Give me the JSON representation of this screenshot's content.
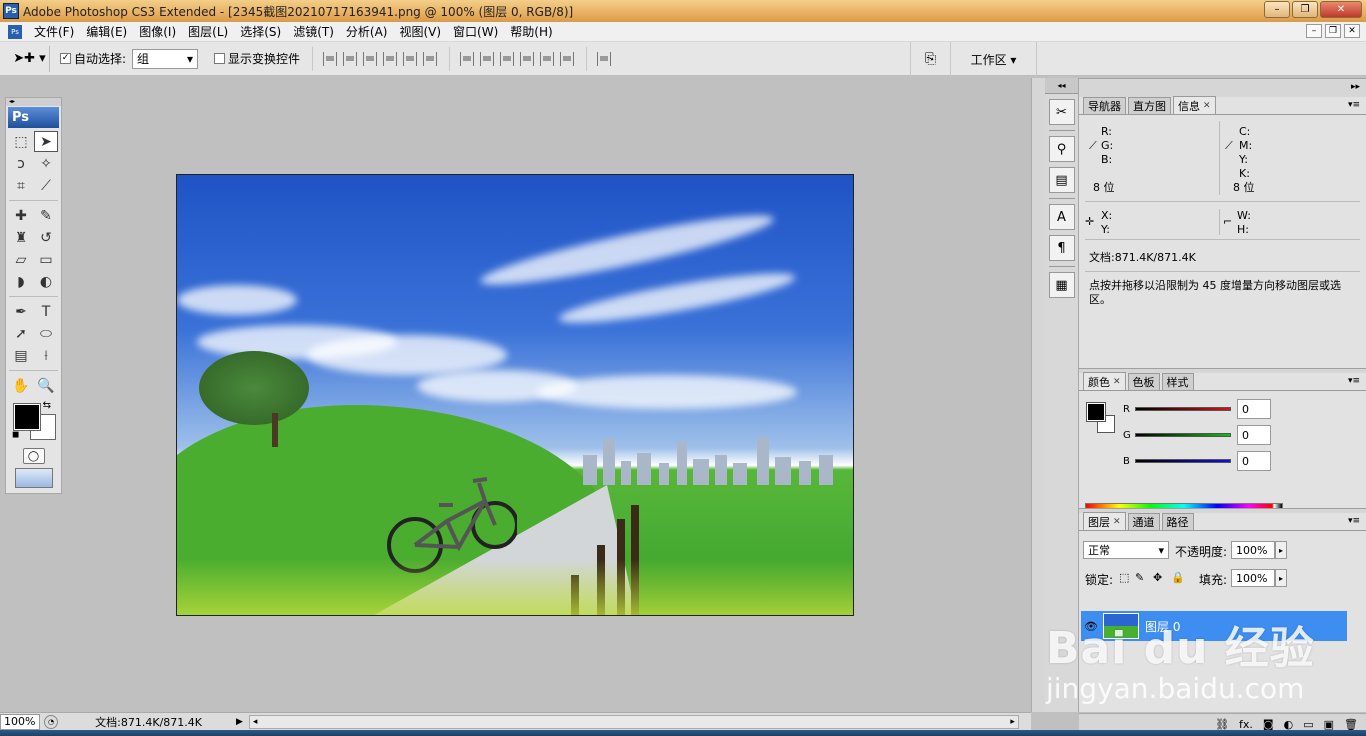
{
  "window": {
    "title": "Adobe Photoshop CS3 Extended - [2345截图20210717163941.png @ 100% (图层 0, RGB/8)]",
    "logo": "Ps",
    "controls": [
      "–",
      "❐",
      "✕"
    ],
    "accent": "#3d8ef0"
  },
  "menu": {
    "items": [
      "文件(F)",
      "编辑(E)",
      "图像(I)",
      "图层(L)",
      "选择(S)",
      "滤镜(T)",
      "分析(A)",
      "视图(V)",
      "窗口(W)",
      "帮助(H)"
    ],
    "doc_controls": [
      "–",
      "❐",
      "✕"
    ]
  },
  "options": {
    "auto_select_label": "自动选择:",
    "auto_select_checked": true,
    "auto_select_value": "组",
    "show_transform_label": "显示变换控件",
    "show_transform_checked": false,
    "workspace_label": "工作区 ▾"
  },
  "toolbox": {
    "header": "Ps",
    "tools": [
      {
        "icon": "marquee-icon",
        "glyph": "⬚"
      },
      {
        "icon": "move-icon",
        "glyph": "➤",
        "active": true
      },
      {
        "icon": "lasso-icon",
        "glyph": "ↄ"
      },
      {
        "icon": "magic-wand-icon",
        "glyph": "✧"
      },
      {
        "icon": "crop-icon",
        "glyph": "⌗"
      },
      {
        "icon": "slice-icon",
        "glyph": "⟋"
      },
      {
        "icon": "healing-icon",
        "glyph": "✚"
      },
      {
        "icon": "brush-icon",
        "glyph": "✎"
      },
      {
        "icon": "stamp-icon",
        "glyph": "♜"
      },
      {
        "icon": "history-brush-icon",
        "glyph": "↺"
      },
      {
        "icon": "eraser-icon",
        "glyph": "▱"
      },
      {
        "icon": "gradient-icon",
        "glyph": "▭"
      },
      {
        "icon": "blur-icon",
        "glyph": "◗"
      },
      {
        "icon": "dodge-icon",
        "glyph": "◐"
      },
      {
        "icon": "pen-icon",
        "glyph": "✒"
      },
      {
        "icon": "type-icon",
        "glyph": "T"
      },
      {
        "icon": "path-select-icon",
        "glyph": "➚"
      },
      {
        "icon": "ellipse-icon",
        "glyph": "⬭"
      },
      {
        "icon": "notes-icon",
        "glyph": "▤"
      },
      {
        "icon": "eyedropper-icon",
        "glyph": "⟊"
      },
      {
        "icon": "hand-icon",
        "glyph": "✋"
      },
      {
        "icon": "zoom-icon",
        "glyph": "🔍"
      }
    ]
  },
  "info_panel": {
    "tabs": [
      "导航器",
      "直方图",
      "信息"
    ],
    "active_tab": "信息",
    "rgb": [
      "R:",
      "G:",
      "B:"
    ],
    "cmyk": [
      "C:",
      "M:",
      "Y:",
      "K:"
    ],
    "bits_left": "8 位",
    "bits_right": "8 位",
    "xy": [
      "X:",
      "Y:"
    ],
    "wh": [
      "W:",
      "H:"
    ],
    "doc": "文档:871.4K/871.4K",
    "hint": "点按并拖移以沿限制为 45 度增量方向移动图层或选区。"
  },
  "color_panel": {
    "tabs": [
      "颜色",
      "色板",
      "样式"
    ],
    "active_tab": "颜色",
    "channels": [
      {
        "label": "R",
        "value": "0",
        "color": "#e01010"
      },
      {
        "label": "G",
        "value": "0",
        "color": "#10c010"
      },
      {
        "label": "B",
        "value": "0",
        "color": "#1010e0"
      }
    ]
  },
  "layers_panel": {
    "tabs": [
      "图层",
      "通道",
      "路径"
    ],
    "active_tab": "图层",
    "blend_mode": "正常",
    "opacity_label": "不透明度:",
    "opacity_value": "100%",
    "lock_label": "锁定:",
    "fill_label": "填充:",
    "fill_value": "100%",
    "layers": [
      {
        "name": "图层 0",
        "visible": true,
        "selected": true
      }
    ],
    "footer_icons": [
      "⛓",
      "fx.",
      "◙",
      "◐",
      "▭",
      "▣",
      "🗑"
    ]
  },
  "status": {
    "zoom": "100%",
    "doc": "文档:871.4K/871.4K"
  },
  "watermark": {
    "big": "Bai du 经验",
    "small": "jingyan.baidu.com"
  }
}
